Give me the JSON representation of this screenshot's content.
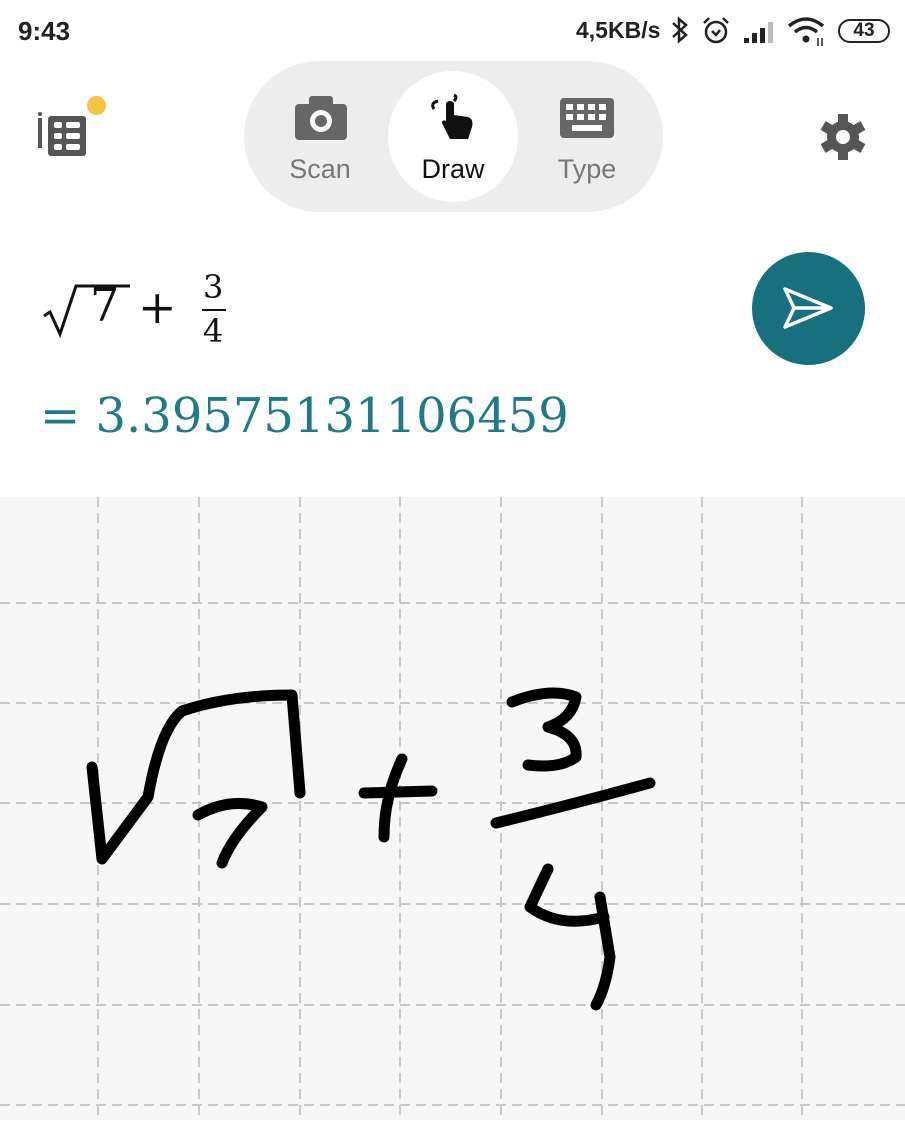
{
  "status_bar": {
    "time": "9:43",
    "network_speed": "4,5KB/s",
    "battery": "43",
    "icons": [
      "bluetooth-icon",
      "alarm-icon",
      "signal-icon",
      "wifi-icon",
      "battery-icon"
    ]
  },
  "header": {
    "history_icon": "history-list-icon",
    "notification_dot_color": "#f6c343",
    "modes": [
      {
        "label": "Scan",
        "icon": "camera-icon",
        "active": false
      },
      {
        "label": "Draw",
        "icon": "hand-draw-icon",
        "active": true
      },
      {
        "label": "Type",
        "icon": "keyboard-icon",
        "active": false
      }
    ],
    "settings_icon": "gear-icon"
  },
  "math": {
    "radicand": "7",
    "plus": "+",
    "numerator": "3",
    "denominator": "4",
    "result": "= 3.39575131106459",
    "result_color": "#1f7a87"
  },
  "send_button": {
    "icon": "send-icon",
    "color": "#17707e"
  },
  "canvas": {
    "handwriting": "√7 + 3/4"
  }
}
